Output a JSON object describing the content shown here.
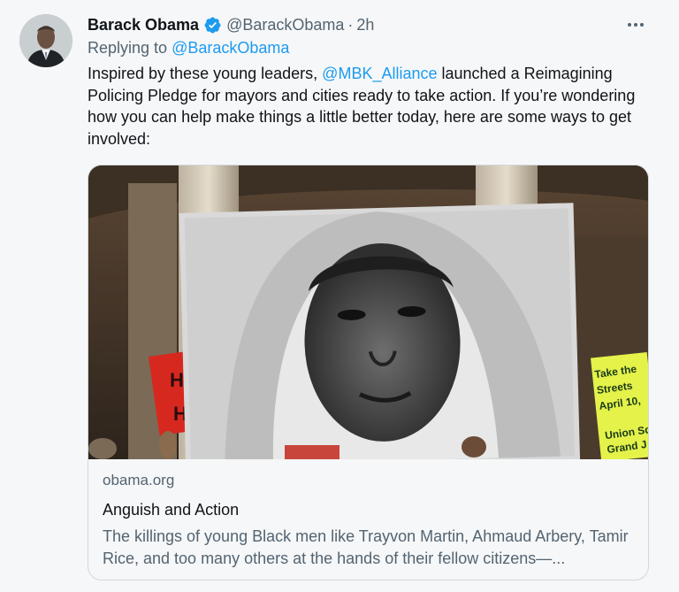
{
  "tweet": {
    "author_name": "Barack Obama",
    "author_handle": "@BarackObama",
    "separator": "·",
    "timestamp": "2h",
    "replying_prefix": "Replying to ",
    "replying_handle": "@BarackObama",
    "text_before_mention": "Inspired by these young leaders, ",
    "mention": "@MBK_Alliance",
    "text_after_mention": " launched a Reimagining Policing Pledge for mayors and cities ready to take action. If you’re wondering how you can help make things a little better today, here are some ways to get involved:"
  },
  "card": {
    "domain": "obama.org",
    "title": "Anguish and Action",
    "description": "The killings of young Black men like Trayvon Martin, Ahmaud Arbery, Tamir Rice, and too many others at the hands of their fellow citizens—...",
    "image_sign_right_lines": [
      "Take the",
      "Streets",
      "April 10,",
      "",
      "Union Sq",
      "Grand J"
    ]
  },
  "icons": {
    "verified": "verified-badge-icon",
    "more": "more-options-icon"
  },
  "colors": {
    "link": "#1d9bf0",
    "text": "#0f1419",
    "muted": "#536471",
    "border": "#cfd9de"
  }
}
